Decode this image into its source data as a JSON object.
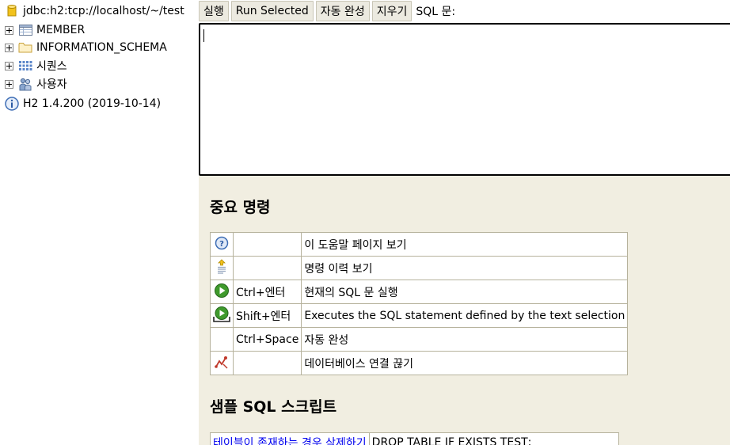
{
  "tree": {
    "connection": "jdbc:h2:tcp://localhost/~/test",
    "items": [
      {
        "label": "MEMBER",
        "icon": "table-icon"
      },
      {
        "label": "INFORMATION_SCHEMA",
        "icon": "folder-icon"
      },
      {
        "label": "시퀀스",
        "icon": "sequence-icon"
      },
      {
        "label": "사용자",
        "icon": "users-icon"
      }
    ],
    "version": "H2 1.4.200 (2019-10-14)"
  },
  "toolbar": {
    "run": "실행",
    "run_selected": "Run Selected",
    "autocomplete": "자동 완성",
    "clear": "지우기",
    "sql_label": "SQL 문:"
  },
  "editor": {
    "value": ""
  },
  "help": {
    "important_title": "중요 명령",
    "commands": [
      {
        "icon": "help-icon",
        "key": "",
        "desc": "이 도움말 페이지 보기"
      },
      {
        "icon": "history-icon",
        "key": "",
        "desc": "명령 이력 보기"
      },
      {
        "icon": "run-icon",
        "key": "Ctrl+엔터",
        "desc": "현재의 SQL 문 실행"
      },
      {
        "icon": "run-selected-icon",
        "key": "Shift+엔터",
        "desc": "Executes the SQL statement defined by the text selection"
      },
      {
        "icon": "",
        "key": "Ctrl+Space",
        "desc": "자동 완성"
      },
      {
        "icon": "disconnect-icon",
        "key": "",
        "desc": "데이터베이스 연결 끊기"
      }
    ],
    "sample_title": "샘플 SQL 스크립트",
    "samples": [
      {
        "link": "테이블이 존재하는 경우 삭제하기",
        "sql": "DROP TABLE IF EXISTS TEST;"
      }
    ]
  },
  "colors": {
    "help_bg": "#f1eee1",
    "button_bg": "#eceae0",
    "link": "#0000ee"
  }
}
